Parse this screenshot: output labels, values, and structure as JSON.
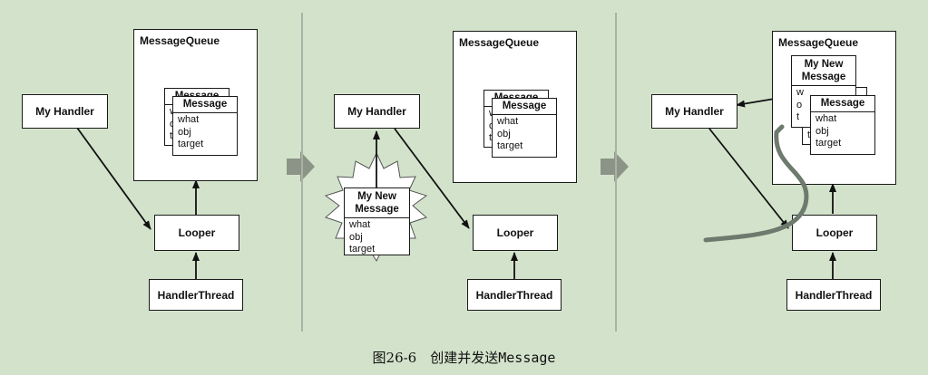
{
  "labels": {
    "message_queue": "MessageQueue",
    "my_handler": "My Handler",
    "looper": "Looper",
    "handler_thread": "HandlerThread",
    "message": "Message",
    "new_message_line1": "My New",
    "new_message_line2": "Message",
    "field_what": "what",
    "field_obj": "obj",
    "field_target": "target",
    "back_msg_what": "w",
    "back_msg_obj": "o",
    "back_msg_target": "t",
    "back_msg3_what": "wh",
    "back_msg3_obj": "ob",
    "back_msg3_target": "ta"
  },
  "caption": {
    "prefix": "图26-6　创建并发送",
    "mono": "Message"
  },
  "colors": {
    "background": "#d3e3cb",
    "separator": "#a8b3a3",
    "step_arrow": "#8c9488",
    "handoff_curve": "#6e7a6e"
  }
}
